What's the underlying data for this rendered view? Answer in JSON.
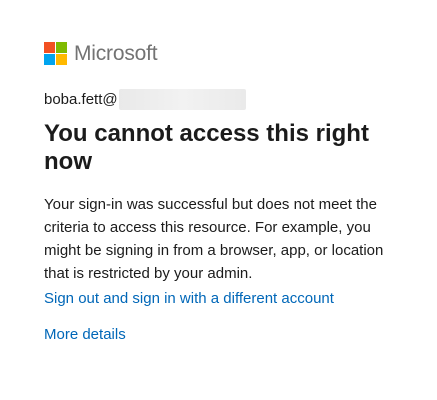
{
  "brand": {
    "name": "Microsoft",
    "logo_icon": "microsoft-logo-icon",
    "logo_colors": [
      "#f25022",
      "#7fba00",
      "#00a4ef",
      "#ffb900"
    ]
  },
  "identity": {
    "user_text": "boba.fett@"
  },
  "main": {
    "title": "You cannot access this right now",
    "description": "Your sign-in was successful but does not meet the criteria to access this resource. For example, you might be signing in from a browser, app, or location that is restricted by your admin."
  },
  "links": {
    "signout_label": "Sign out and sign in with a different account",
    "details_label": "More details"
  },
  "colors": {
    "text": "#1b1b1b",
    "link": "#0067b8",
    "brand_text": "#737373"
  }
}
